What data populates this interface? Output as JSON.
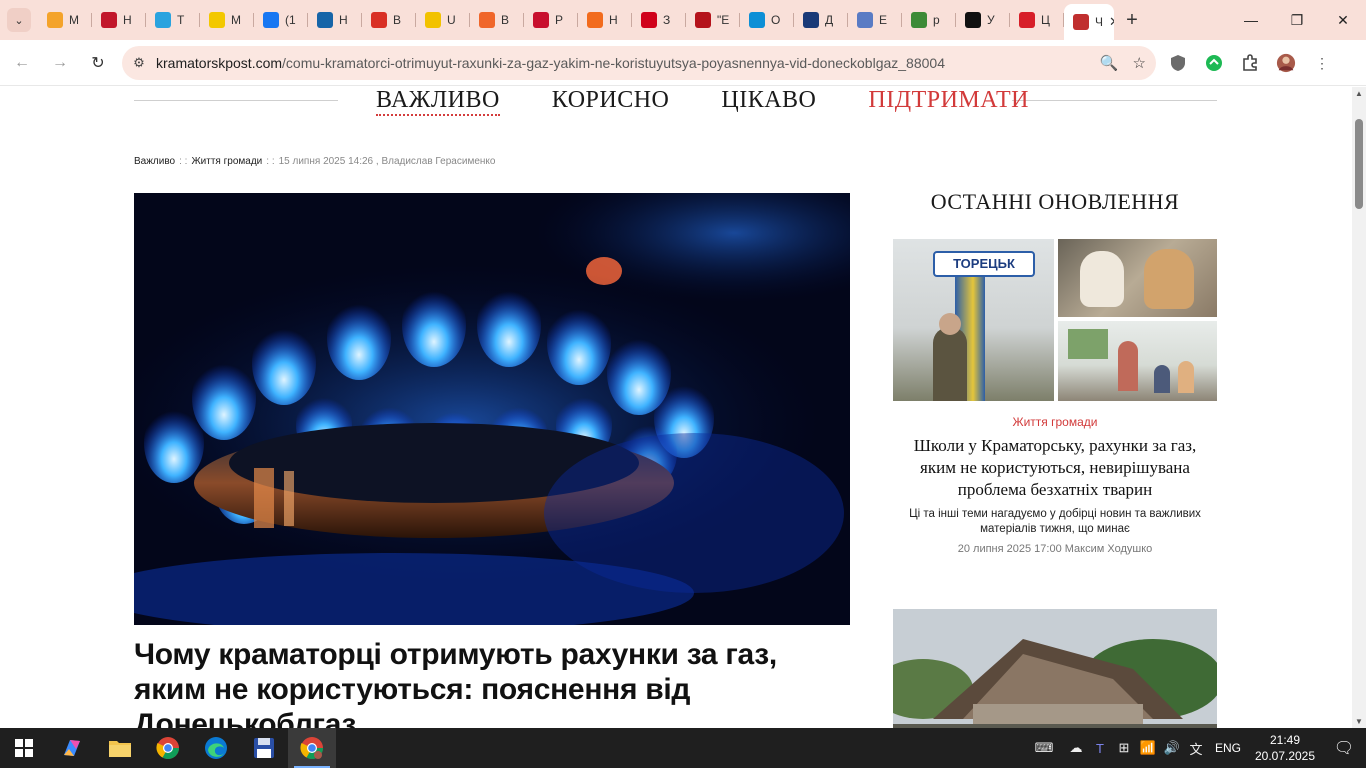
{
  "browser": {
    "tabs": [
      {
        "label": "M",
        "icon": "joomla-icon",
        "color": "#f4a32b"
      },
      {
        "label": "Н",
        "icon": "h-logo-icon",
        "color": "#c2172b"
      },
      {
        "label": "Т",
        "icon": "telegram-icon",
        "color": "#2aa3df"
      },
      {
        "label": "М",
        "icon": "ukraine-flag-icon",
        "color": "#f3c800"
      },
      {
        "label": "(1",
        "icon": "facebook-icon",
        "color": "#1877f2"
      },
      {
        "label": "Н",
        "icon": "ki-logo-icon",
        "color": "#1765a8"
      },
      {
        "label": "В",
        "icon": "gmail-icon",
        "color": "#d93025"
      },
      {
        "label": "U",
        "icon": "u-logo-icon",
        "color": "#f2c200"
      },
      {
        "label": "В",
        "icon": "brave-icon",
        "color": "#f0662a"
      },
      {
        "label": "Р",
        "icon": "ua-logo-icon",
        "color": "#c8102e"
      },
      {
        "label": "Н",
        "icon": "oo-logo-icon",
        "color": "#f26b1d"
      },
      {
        "label": "З",
        "icon": "flag-logo-icon",
        "color": "#d0021b"
      },
      {
        "label": "\"Е",
        "icon": "b-logo-icon",
        "color": "#b5131b"
      },
      {
        "label": "О",
        "icon": "circle-logo-icon",
        "color": "#0d8fd6"
      },
      {
        "label": "Д",
        "icon": "emblem-icon",
        "color": "#1a3a78"
      },
      {
        "label": "Е",
        "icon": "document-icon",
        "color": "#5a7bc4"
      },
      {
        "label": "р",
        "icon": "gear-logo-icon",
        "color": "#3d8b37"
      },
      {
        "label": "У",
        "icon": "k-logo-icon",
        "color": "#111111"
      },
      {
        "label": "Ц",
        "icon": "k-red-logo-icon",
        "color": "#d71e28"
      },
      {
        "label": "Ч",
        "icon": "kramatorsk-post-icon",
        "color": "#c02f2f"
      }
    ],
    "url_host": "kramatorskpost.com",
    "url_path": "/comu-kramatorci-otrimuyut-raxunki-za-gaz-yakim-ne-koristuyutsya-poyasnennya-vid-doneckoblgaz_88004"
  },
  "nav": {
    "items": [
      "ВАЖЛИВО",
      "КОРИСНО",
      "ЦІКАВО",
      "ПІДТРИМАТИ"
    ]
  },
  "article": {
    "category": "Важливо",
    "subcategory": "Життя громади",
    "date_author": "15 липня 2025 14:26 , Владислав Герасименко",
    "title": "Чому краматорці отримують рахунки за газ, яким не користуються: пояснення від Донецькоблгаз"
  },
  "sidebar": {
    "heading": "ОСТАННІ ОНОВЛЕННЯ",
    "card": {
      "category": "Життя громади",
      "title": "Школи у Краматорську, рахунки за газ, яким не користуються, невирішувана проблема безхатніх тварин",
      "description": "Ці та інші теми нагадуємо у добірці новин та важливих матеріалів тижня, що минає",
      "byline": "20 липня 2025 17:00 Максим Ходушко",
      "image_sign_text": "ТОРЕЦЬК"
    }
  },
  "taskbar": {
    "time": "21:49",
    "date": "20.07.2025",
    "lang": "ENG"
  }
}
